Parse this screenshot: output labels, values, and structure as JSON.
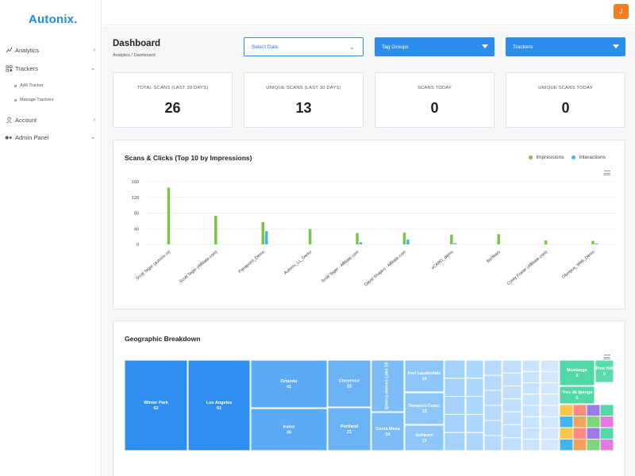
{
  "app": {
    "logo": "Autonix."
  },
  "sidebar": {
    "items": [
      {
        "label": "Analytics",
        "icon": "analytics-icon"
      },
      {
        "label": "Trackers",
        "icon": "trackers-icon"
      },
      {
        "label": "Account",
        "icon": "user-icon"
      },
      {
        "label": "Admin Panel",
        "icon": "admin-icon"
      }
    ],
    "subitems": [
      {
        "label": "Add Tracker"
      },
      {
        "label": "Manage Trackers"
      }
    ]
  },
  "topbar": {
    "avatar_initial": "J",
    "avatar_color": "#f57c1f"
  },
  "page": {
    "title": "Dashboard",
    "breadcrumb": "Analytics / Dashboard"
  },
  "filters": {
    "date_placeholder": "Select Date",
    "tag_groups": "Tag Groups",
    "trackers": "Trackers"
  },
  "stats": [
    {
      "label": "TOTAL SCANS (LAST 30 DAYS)",
      "value": "26"
    },
    {
      "label": "UNIQUE SCANS (LAST 30 DAYS)",
      "value": "13"
    },
    {
      "label": "SCANS TODAY",
      "value": "0"
    },
    {
      "label": "UNIQUE SCANS TODAY",
      "value": "0"
    }
  ],
  "scans_chart": {
    "title": "Scans & Clicks (Top 10 by Impressions)",
    "legend": [
      "Impressions",
      "Interactions"
    ]
  },
  "geo": {
    "title": "Geographic Breakdown"
  },
  "colors": {
    "accent": "#2d8cf0",
    "impressions": "#7cc34a",
    "interactions": "#3fb6ee",
    "orange": "#f57c1f"
  },
  "chart_data": [
    {
      "type": "bar",
      "title": "Scans & Clicks (Top 10 by Impressions)",
      "categories": [
        "Scott Teger (autonix.io)",
        "Scott Teger (Affiliate.com)",
        "Panapoint_Demo",
        "Autonix_LL_Demo",
        "Scott Teger - Affiliate.com",
        "David Shapiro - Affiliate.com",
        "vCARD_demo",
        "Biz!fears",
        "Corey Foster (Affiliate.com)",
        "Olympus_Web_Demo"
      ],
      "series": [
        {
          "name": "Impressions",
          "values": [
            145,
            73,
            57,
            39,
            29,
            30,
            25,
            26,
            10,
            9
          ]
        },
        {
          "name": "Interactions",
          "values": [
            0,
            0,
            34,
            0,
            5,
            12,
            3,
            0,
            0,
            2
          ]
        }
      ],
      "yticks": [
        "0",
        "40",
        "80",
        "120",
        "160"
      ],
      "ylim": [
        0,
        160
      ],
      "grid": true,
      "legend_position": "top-right"
    },
    {
      "type": "treemap",
      "title": "Geographic Breakdown",
      "items": [
        {
          "name": "Winter Park",
          "value": 62
        },
        {
          "name": "Los Angeles",
          "value": 61
        },
        {
          "name": "Orlando",
          "value": 41
        },
        {
          "name": "Irvine",
          "value": 35
        },
        {
          "name": "Cheyenne",
          "value": 22
        },
        {
          "name": "Portland",
          "value": 21
        },
        {
          "name": "Quincy-moses Lake",
          "value": 18
        },
        {
          "name": "Costa Mesa",
          "value": 14
        },
        {
          "name": "Fort Lauderdale",
          "value": 14
        },
        {
          "name": "Newport Coast",
          "value": 13
        },
        {
          "name": "Ashburn",
          "value": 13
        },
        {
          "name": "Mustangs",
          "value": 8
        },
        {
          "name": "Pine Hill",
          "value": 5
        },
        {
          "name": "Tres de Ipanga",
          "value": 6
        }
      ]
    }
  ]
}
